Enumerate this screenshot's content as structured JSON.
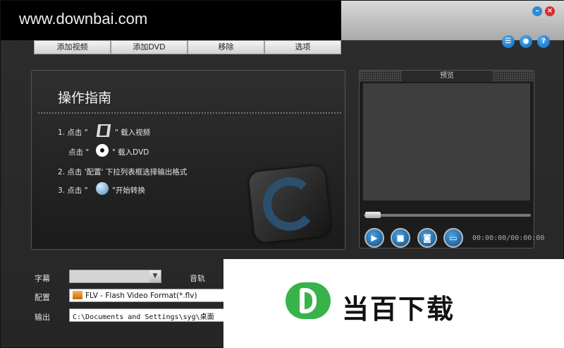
{
  "watermark": "www.downbai.com",
  "window": {
    "minimize": "–",
    "close": "×"
  },
  "tabs": [
    {
      "label": "添加视频"
    },
    {
      "label": "添加DVD"
    },
    {
      "label": "移除"
    },
    {
      "label": "选项"
    }
  ],
  "top_icons": [
    {
      "name": "list-icon",
      "glyph": "☰"
    },
    {
      "name": "user-icon",
      "glyph": "●"
    },
    {
      "name": "help-icon",
      "glyph": "?"
    }
  ],
  "guide": {
    "title": "操作指南",
    "step1_a": "1. 点击 \"",
    "step1_b": "\" 载入视频",
    "step1c_a": "点击 \"",
    "step1c_b": "\" 载入DVD",
    "step2": "2. 点击 '配置' 下拉列表框选择输出格式",
    "step3_a": "3. 点击 \"",
    "step3_b": "\"开始转换"
  },
  "preview": {
    "label": "预览",
    "timecode": "00:00:00/00:00:00",
    "seek_fraction": 0.0
  },
  "bottom": {
    "subtitle_label": "字幕",
    "audio_label": "音轨",
    "profile_label": "配置",
    "profile_value": "FLV - Flash Video Format(*.flv)",
    "output_label": "输出",
    "output_value": "C:\\Documents and Settings\\syg\\桌面"
  },
  "ad": {
    "text": "当百下载"
  }
}
